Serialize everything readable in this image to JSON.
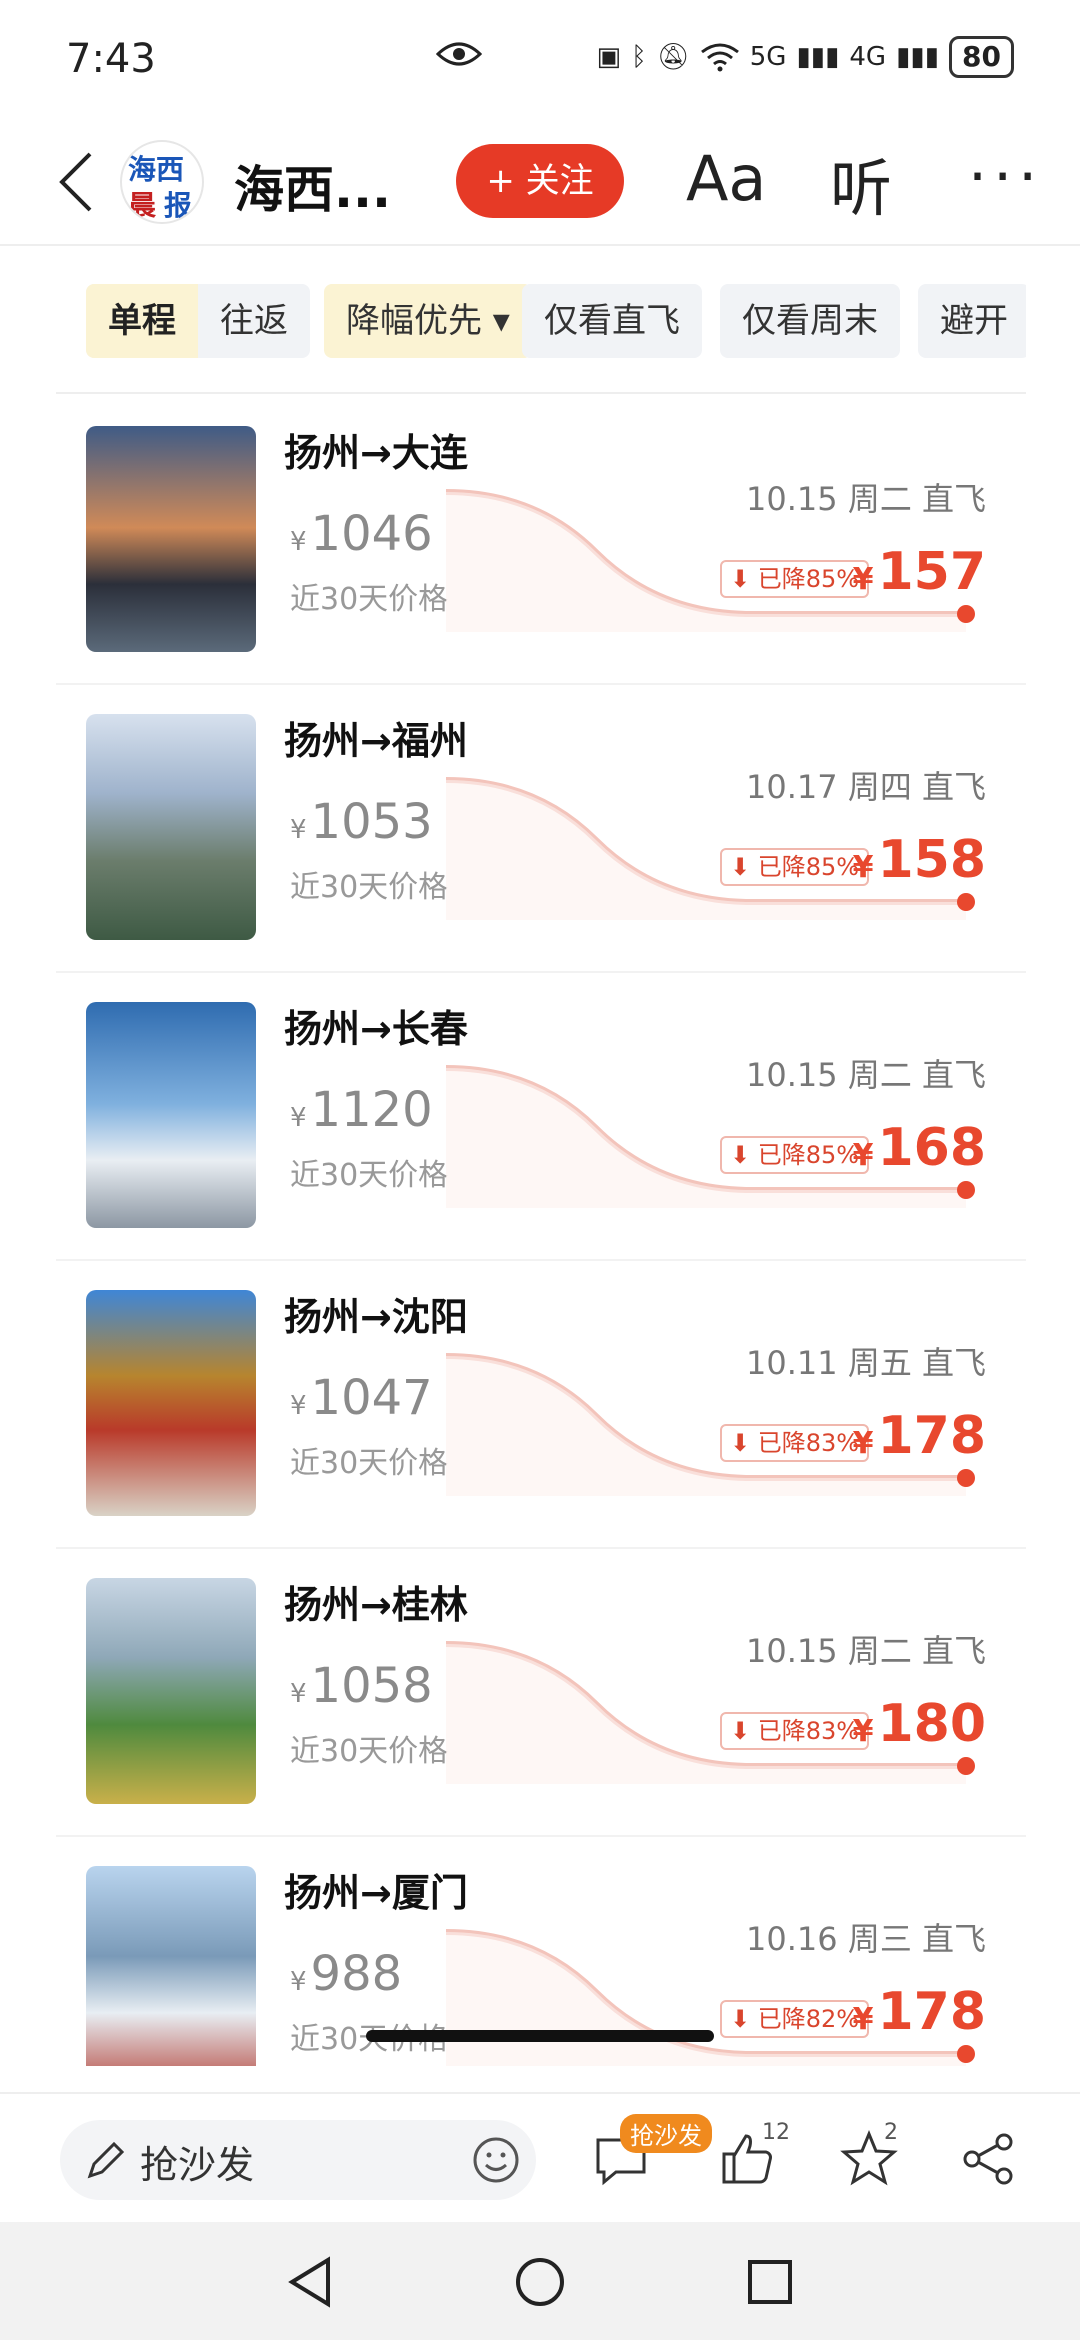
{
  "status": {
    "time": "7:43",
    "battery": "80",
    "net1": "5G",
    "net2": "4G"
  },
  "header": {
    "logo_line1": "海西",
    "logo_line2a": "晨",
    "logo_line2b": "报",
    "source": "海西...",
    "follow_label": "+ 关注",
    "font_label": "Aa",
    "listen_label": "听"
  },
  "filters": {
    "trip_types": [
      "单程",
      "往返"
    ],
    "chips": [
      "降幅优先 ▾",
      "仅看直飞",
      "仅看周末",
      "避开"
    ]
  },
  "flights": [
    {
      "route": "扬州→大连",
      "old_price": "1046",
      "old_label": "近30天价格",
      "date": "10.15 周二 直飞",
      "drop": "已降85%",
      "price": "157"
    },
    {
      "route": "扬州→福州",
      "old_price": "1053",
      "old_label": "近30天价格",
      "date": "10.17 周四 直飞",
      "drop": "已降85%",
      "price": "158"
    },
    {
      "route": "扬州→长春",
      "old_price": "1120",
      "old_label": "近30天价格",
      "date": "10.15 周二 直飞",
      "drop": "已降85%",
      "price": "168"
    },
    {
      "route": "扬州→沈阳",
      "old_price": "1047",
      "old_label": "近30天价格",
      "date": "10.11 周五 直飞",
      "drop": "已降83%",
      "price": "178"
    },
    {
      "route": "扬州→桂林",
      "old_price": "1058",
      "old_label": "近30天价格",
      "date": "10.15 周二 直飞",
      "drop": "已降83%",
      "price": "180"
    },
    {
      "route": "扬州→厦门",
      "old_price": "988",
      "old_label": "近30天价格",
      "date": "10.16 周三 直飞",
      "drop": "已降82%",
      "price": "178"
    }
  ],
  "currency": "¥",
  "bottom": {
    "comment_placeholder": "抢沙发",
    "comment_tag": "抢沙发",
    "likes": "12",
    "favorites": "2"
  },
  "colors": {
    "accent": "#e63a26",
    "price": "#e8482e",
    "filter_active": "#fbf3d3"
  }
}
